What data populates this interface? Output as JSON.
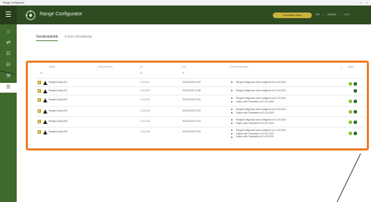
{
  "window": {
    "title": "Range Configurator",
    "minimize_glyph": "–",
    "maximize_glyph": "□",
    "close_glyph": "×"
  },
  "header": {
    "app_title": "Range Configurator",
    "status_label": "Simulation Mode",
    "user_label": "DE",
    "admin_label": "ADMIN",
    "version_label": "1.0.0",
    "colors": {
      "bar": "#2f4b22",
      "accent": "#c8b43a"
    }
  },
  "sidebar": {
    "items": [
      {
        "icon": "home-icon",
        "glyph": "⌂"
      },
      {
        "icon": "swap-icon",
        "glyph": "⇄"
      },
      {
        "icon": "document-icon",
        "glyph": "☷"
      },
      {
        "icon": "grid-icon",
        "glyph": "☷"
      },
      {
        "icon": "wrench-icon",
        "glyph": "⚒"
      },
      {
        "icon": "archive-icon",
        "glyph": "☰"
      }
    ],
    "active_index": 5
  },
  "tabs": [
    {
      "label": "Sendestatistik",
      "active": true
    },
    {
      "label": "Event Verwaltung",
      "active": false
    }
  ],
  "table": {
    "columns": [
      "Status",
      "Beschreibung",
      "ID",
      "Zeit",
      "Fehlermeldungen",
      "Aktion"
    ],
    "filters": [
      "N",
      "",
      "N",
      "N",
      "",
      ""
    ],
    "rows": [
      {
        "name": "RangeConfig-001",
        "id": "1.1.2.1.1",
        "time": "28.03.2023 10:42",
        "messages": [
          "RangeConfigurator was configured at 11.03.2023"
        ]
      },
      {
        "name": "RangeConfig-002",
        "id": "1.1.2.1.2",
        "time": "28.03.2023 10:38",
        "messages": [
          "RangeConfigurator was configured at 11.03.2023"
        ]
      },
      {
        "name": "RangeConfig-003",
        "id": "1.1.2.1.3",
        "time": "28.03.2023 10:31",
        "messages": [
          "RangeConfigurator was configured at 11.03.2023",
          "Failure with Parameter at 21.03.2023"
        ]
      },
      {
        "name": "RangeConfig-004",
        "id": "1.1.2.1.4",
        "time": "28.03.2023 10:22",
        "messages": [
          "RangeConfigurator was configured at 11.03.2023",
          "Failure with Parameter at 21.03.2023"
        ]
      },
      {
        "name": "RangeConfig-005",
        "id": "1.1.2.1.5",
        "time": "28.03.2023 10:14",
        "messages": [
          "RangeConfigurator was configured at 11.03.2023",
          "Failure with Parameter at 21.03.2023"
        ]
      },
      {
        "name": "RangeConfig-006",
        "id": "1.1.2.1.6",
        "time": "28.03.2023 10:03",
        "messages": [
          "RangeConfigurator was configured at 11.03.2023",
          "Failure with Parameter at 21.03.2023",
          "Failure with Parameter at 21.03.2023"
        ]
      }
    ]
  },
  "colors": {
    "highlight": "#ef7a22",
    "sidebar": "#3f6a2b",
    "check": "#e8c54a"
  }
}
